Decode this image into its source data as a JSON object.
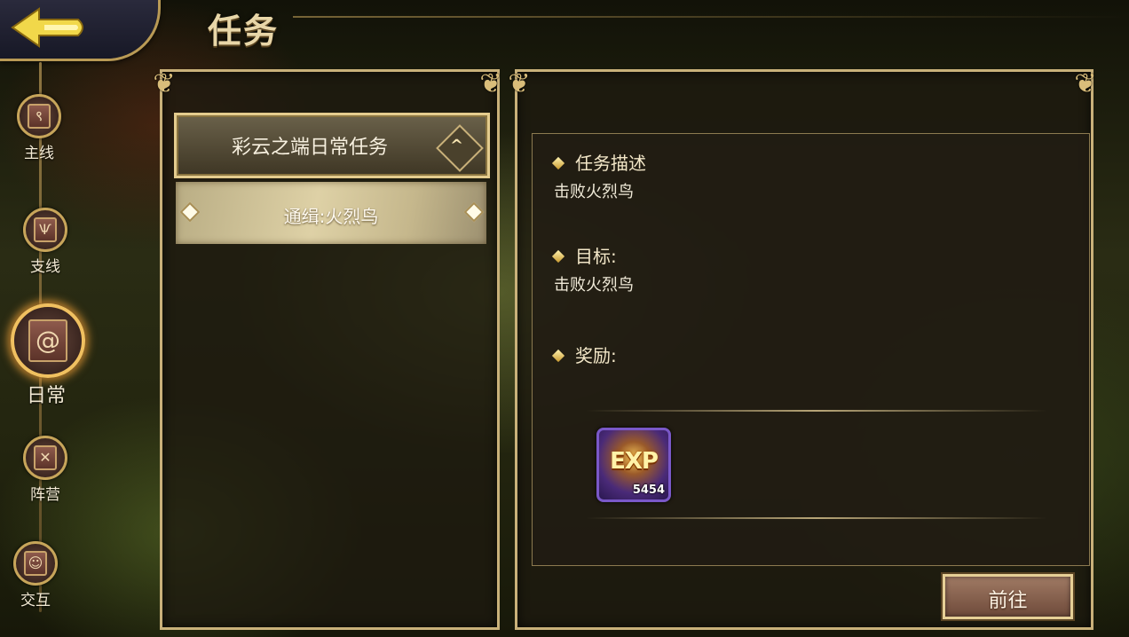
{
  "header": {
    "title": "任务"
  },
  "sidebar": {
    "items": [
      {
        "label": "主线",
        "icon": "scroll-main-icon"
      },
      {
        "label": "支线",
        "icon": "scroll-branch-icon"
      },
      {
        "label": "日常",
        "icon": "scroll-daily-icon",
        "active": true
      },
      {
        "label": "阵营",
        "icon": "scroll-faction-icon"
      },
      {
        "label": "交互",
        "icon": "scroll-interact-icon"
      }
    ]
  },
  "quest_list": {
    "group_label": "彩云之端日常任务",
    "items": [
      {
        "label": "通缉:火烈鸟",
        "selected": true
      }
    ]
  },
  "details": {
    "description_title": "任务描述",
    "description_text": "击败火烈鸟",
    "goal_title": "目标:",
    "goal_text": "击败火烈鸟",
    "reward_title": "奖励:",
    "rewards": [
      {
        "type": "EXP",
        "label": "EXP",
        "amount": "5454"
      }
    ]
  },
  "actions": {
    "go_label": "前往"
  },
  "colors": {
    "frame_gold": "#c9b17a",
    "panel_bg": "#1e1a10",
    "active_glow": "#f0c060"
  }
}
